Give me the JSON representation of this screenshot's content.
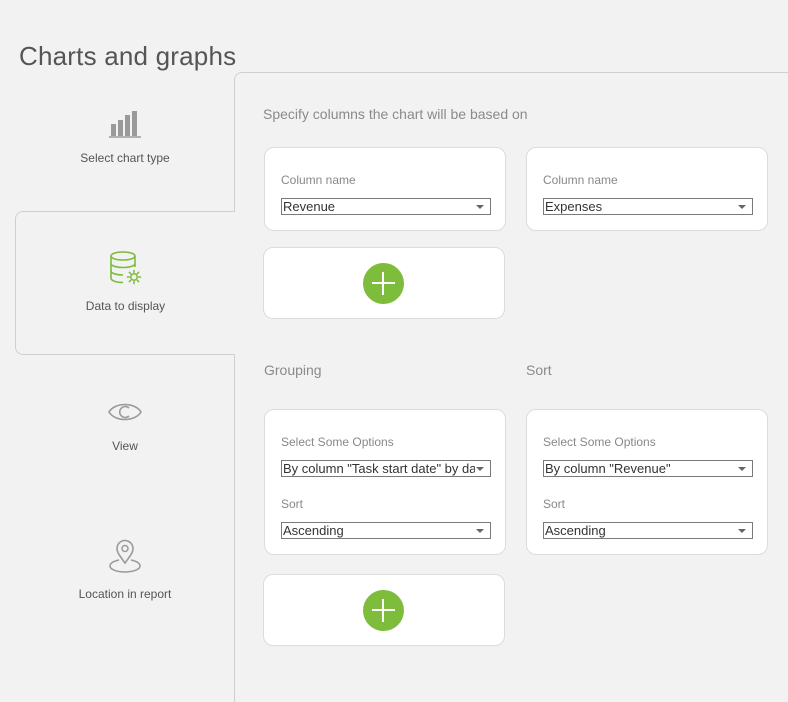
{
  "page": {
    "title": "Charts and graphs"
  },
  "sidebar": {
    "items": [
      {
        "label": "Select chart type",
        "icon": "bar-chart-icon"
      },
      {
        "label": "Data to display",
        "icon": "database-gear-icon",
        "active": true
      },
      {
        "label": "View",
        "icon": "eye-icon"
      },
      {
        "label": "Location in report",
        "icon": "map-pin-icon"
      }
    ]
  },
  "main": {
    "instruction": "Specify columns the chart will be based on",
    "columns": [
      {
        "label": "Column name",
        "value": "Revenue"
      },
      {
        "label": "Column name",
        "value": "Expenses"
      }
    ],
    "grouping": {
      "heading": "Grouping",
      "options_label": "Select Some Options",
      "options_value": "By column \"Task start date\" by date",
      "sort_label": "Sort",
      "sort_value": "Ascending"
    },
    "sort": {
      "heading": "Sort",
      "options_label": "Select Some Options",
      "options_value": "By column \"Revenue\"",
      "sort_label": "Sort",
      "sort_value": "Ascending"
    }
  },
  "colors": {
    "accent_green": "#7ebc3b",
    "background": "#f2f2f2",
    "card": "#ffffff",
    "active_icon": "#7ebc3b"
  }
}
